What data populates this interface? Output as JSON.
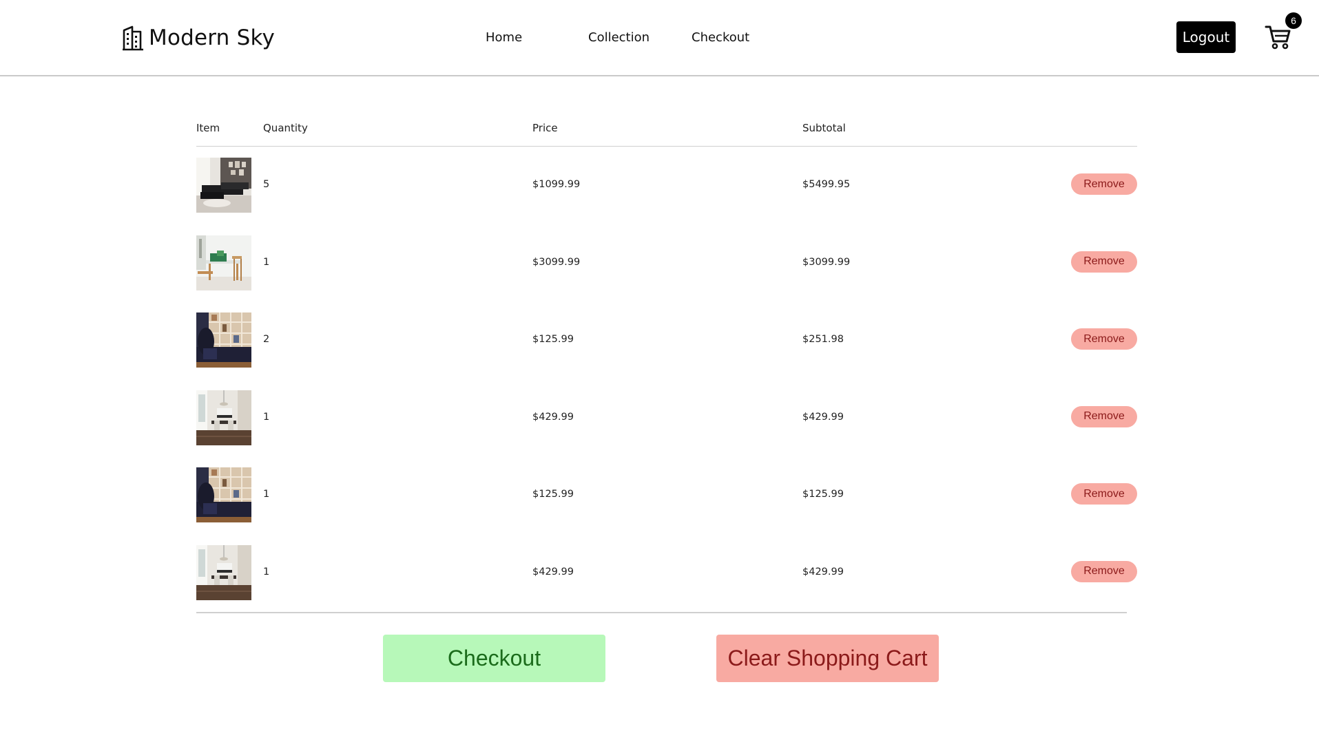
{
  "brand": {
    "name": "Modern Sky",
    "icon": "building-icon"
  },
  "nav": [
    {
      "label": "Home"
    },
    {
      "label": "Collection"
    },
    {
      "label": "Checkout"
    }
  ],
  "header": {
    "logout_label": "Logout",
    "cart_icon": "shopping-cart-icon",
    "cart_count": "6"
  },
  "table": {
    "headers": [
      "Item",
      "Quantity",
      "Price",
      "Subtotal"
    ],
    "rows": [
      {
        "image": "black-sectional-sofa-photo",
        "quantity": "5",
        "price": "$1099.99",
        "subtotal": "$5499.95",
        "remove_label": "Remove"
      },
      {
        "image": "dining-table-chairs-photo",
        "quantity": "1",
        "price": "$3099.99",
        "subtotal": "$3099.99",
        "remove_label": "Remove"
      },
      {
        "image": "bookshelf-armchair-photo",
        "quantity": "2",
        "price": "$125.99",
        "subtotal": "$251.98",
        "remove_label": "Remove"
      },
      {
        "image": "dining-room-photo",
        "quantity": "1",
        "price": "$429.99",
        "subtotal": "$429.99",
        "remove_label": "Remove"
      },
      {
        "image": "bookshelf-armchair-photo",
        "quantity": "1",
        "price": "$125.99",
        "subtotal": "$125.99",
        "remove_label": "Remove"
      },
      {
        "image": "dining-room-photo",
        "quantity": "1",
        "price": "$429.99",
        "subtotal": "$429.99",
        "remove_label": "Remove"
      }
    ]
  },
  "actions": {
    "checkout_label": "Checkout",
    "clear_label": "Clear Shopping Cart"
  },
  "colors": {
    "checkout_bg": "#b7f8b9",
    "checkout_text": "#1b6b1b",
    "remove_bg": "#f8aaa2",
    "remove_text": "#8b1a1a",
    "logout_bg": "#000000"
  }
}
